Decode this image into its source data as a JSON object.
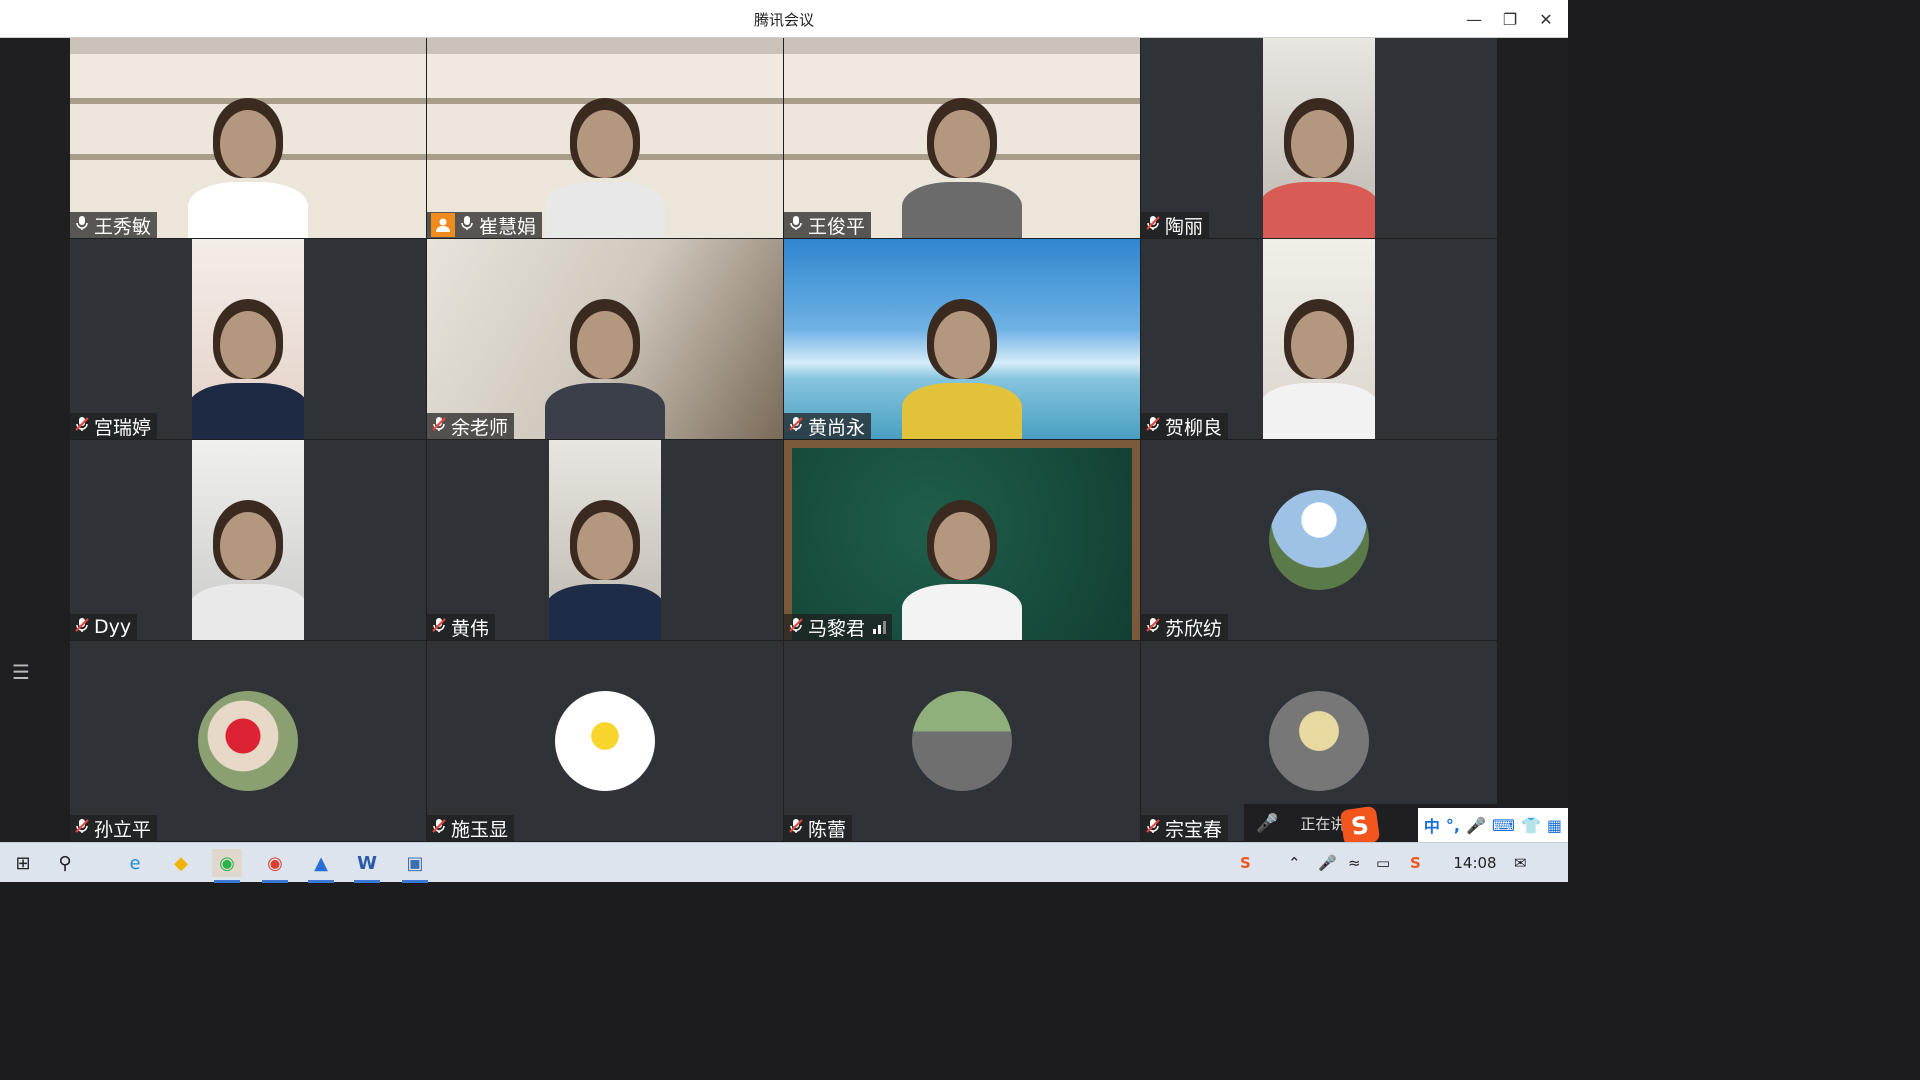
{
  "window": {
    "title": "腾讯会议",
    "minimize_icon": "minimize-icon",
    "restore_icon": "restore-icon",
    "close_icon": "close-icon"
  },
  "participants": [
    {
      "name": "王秀敏",
      "mic": "on",
      "host": false,
      "active_speaker": false,
      "video": "shelf"
    },
    {
      "name": "崔慧娟",
      "mic": "on",
      "host": true,
      "active_speaker": false,
      "video": "shelf"
    },
    {
      "name": "王俊平",
      "mic": "on",
      "host": false,
      "active_speaker": true,
      "video": "shelf"
    },
    {
      "name": "陶丽",
      "mic": "muted",
      "host": false,
      "active_speaker": false,
      "video": "portrait"
    },
    {
      "name": "宫瑞婷",
      "mic": "muted",
      "host": false,
      "active_speaker": false,
      "video": "portrait"
    },
    {
      "name": "余老师",
      "mic": "muted",
      "host": false,
      "active_speaker": false,
      "video": "room"
    },
    {
      "name": "黄尚永",
      "mic": "muted",
      "host": false,
      "active_speaker": false,
      "video": "sky"
    },
    {
      "name": "贺柳良",
      "mic": "muted",
      "host": false,
      "active_speaker": false,
      "video": "portrait"
    },
    {
      "name": "Dyy",
      "mic": "muted",
      "host": false,
      "active_speaker": false,
      "video": "portrait"
    },
    {
      "name": "黄伟",
      "mic": "muted",
      "host": false,
      "active_speaker": false,
      "video": "portrait"
    },
    {
      "name": "马黎君",
      "mic": "muted",
      "host": false,
      "active_speaker": false,
      "video": "chalkboard",
      "signal_bars": 2
    },
    {
      "name": "苏欣纺",
      "mic": "muted",
      "host": false,
      "active_speaker": false,
      "video": "avatar"
    },
    {
      "name": "孙立平",
      "mic": "muted",
      "host": false,
      "active_speaker": false,
      "video": "avatar"
    },
    {
      "name": "施玉显",
      "mic": "muted",
      "host": false,
      "active_speaker": false,
      "video": "avatar"
    },
    {
      "name": "陈蕾",
      "mic": "muted",
      "host": false,
      "active_speaker": false,
      "video": "avatar"
    },
    {
      "name": "宗宝春",
      "mic": "muted",
      "host": false,
      "active_speaker": false,
      "video": "avatar"
    }
  ],
  "speaking_bar": {
    "text": "正在讲话"
  },
  "ime_toolbar": {
    "mode": "中",
    "punct": "°,"
  },
  "taskbar": {
    "apps": [
      "windows-start-icon",
      "search-icon",
      "edge-icon",
      "norton-icon",
      "wechat-icon",
      "chrome-icon",
      "tencent-meeting-icon",
      "word-icon",
      "remote-desktop-icon"
    ],
    "time": "14:08"
  },
  "colors": {
    "active_speaker_border": "#22c46a",
    "host_badge": "#f08c1e",
    "tile_bg": "#2f3237"
  }
}
